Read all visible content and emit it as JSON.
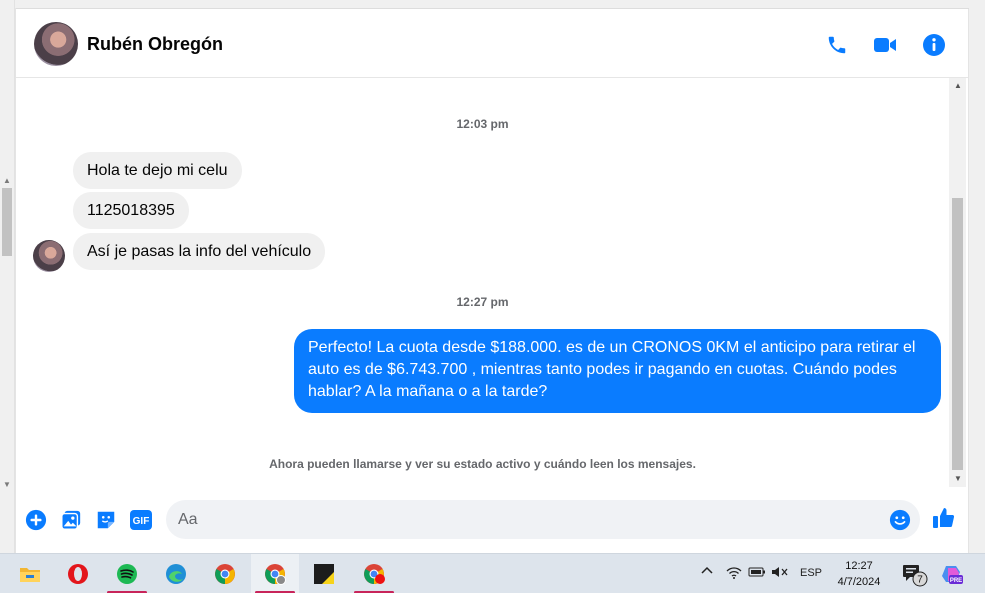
{
  "contact": {
    "name": "Rubén Obregón"
  },
  "header_icons": {
    "call": "phone-icon",
    "video": "video-camera-icon",
    "info": "info-icon"
  },
  "messages": {
    "time_1": "12:03 pm",
    "incoming": [
      "Hola te dejo mi celu",
      "1125018395",
      "Así je pasas la info del vehículo"
    ],
    "time_2": "12:27 pm",
    "outgoing": "Perfecto! La cuota desde $188.000. es de un CRONOS 0KM el anticipo para retirar el auto es de $6.743.700 , mientras tanto podes ir pagando en cuotas. Cuándo podes hablar? A la mañana o a la tarde?",
    "notice": "Ahora pueden llamarse y ver su estado activo y cuándo leen los mensajes."
  },
  "composer": {
    "placeholder": "Aa",
    "icons": [
      "plus-icon",
      "photo-icon",
      "sticker-icon",
      "gif-icon",
      "emoji-icon",
      "thumbs-up-icon"
    ],
    "gif_label": "GIF"
  },
  "taskbar": {
    "apps": [
      "file-explorer-icon",
      "opera-icon",
      "spotify-icon",
      "edge-icon",
      "chrome-icon",
      "chrome-profile-icon",
      "sticky-notes-icon",
      "chrome-notification-icon"
    ],
    "language": "ESP",
    "time": "12:27",
    "date": "4/7/2024",
    "notification_count": "7",
    "copilot_badge": "PRE"
  },
  "colors": {
    "accent": "#0a7cff",
    "bubble_in": "#f0f0f0",
    "taskbar": "#dde4ec"
  }
}
